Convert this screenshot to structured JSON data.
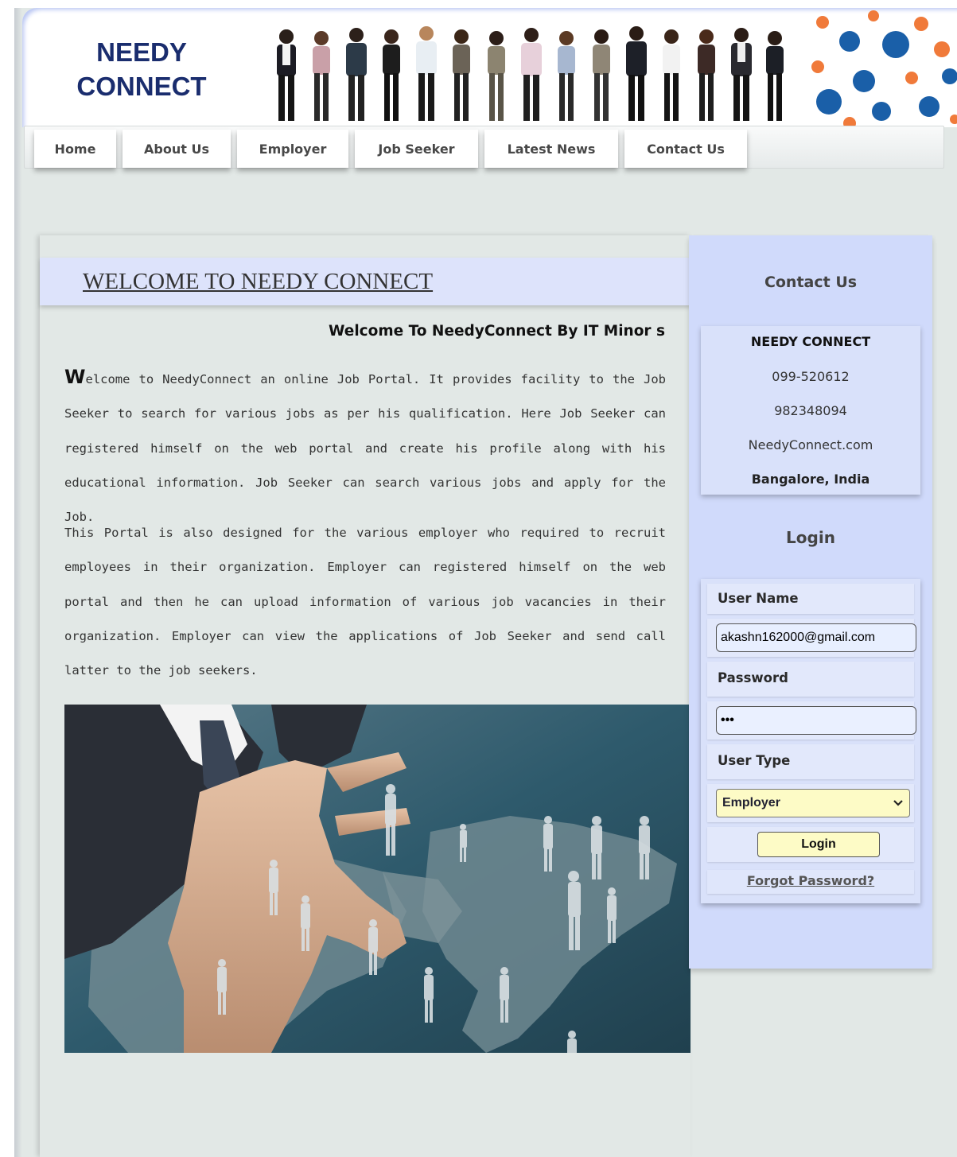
{
  "brand": {
    "line1": "NEEDY",
    "line2": "CONNECT"
  },
  "nav": {
    "items": [
      {
        "label": "Home"
      },
      {
        "label": "About Us"
      },
      {
        "label": "Employer"
      },
      {
        "label": "Job Seeker"
      },
      {
        "label": "Latest News"
      },
      {
        "label": "Contact Us"
      }
    ]
  },
  "main": {
    "title": "WELCOME TO NEEDY CONNECT",
    "subheading": "Welcome To NeedyConnect By IT Minor s",
    "para1_dropcap": "W",
    "para1_rest": "elcome to NeedyConnect an online Job Portal. It provides facility to the Job Seeker to search for various jobs as per his qualification. Here Job Seeker can registered himself on the web portal and create his profile along with his educational information. Job Seeker can search various jobs and apply for the Job.",
    "para2": "This Portal is also designed for the various employer who required to recruit employees in their organization. Employer can registered himself on the web portal and then he can upload information of various job vacancies in their organization. Employer can view the applications of Job Seeker and send call latter to the job seekers."
  },
  "sidebar": {
    "contact_heading": "Contact Us",
    "contact": {
      "name": "NEEDY CONNECT",
      "phone1": "099-520612",
      "phone2": "982348094",
      "website": "NeedyConnect.com",
      "location": "Bangalore, India"
    },
    "login_heading": "Login",
    "login": {
      "username_label": "User Name",
      "username_value": "akashn162000@gmail.com",
      "password_label": "Password",
      "password_value": "•••",
      "usertype_label": "User Type",
      "usertype_value": "Employer",
      "login_button": "Login",
      "forgot_link": "Forgot Password?"
    }
  },
  "colors": {
    "brand": "#1a2d6e",
    "sidebar_bg": "#d0dafb",
    "welcome_bar": "#dde3fb",
    "page_bg": "#e2e8e6",
    "button_yellow": "#fdfbc6"
  }
}
